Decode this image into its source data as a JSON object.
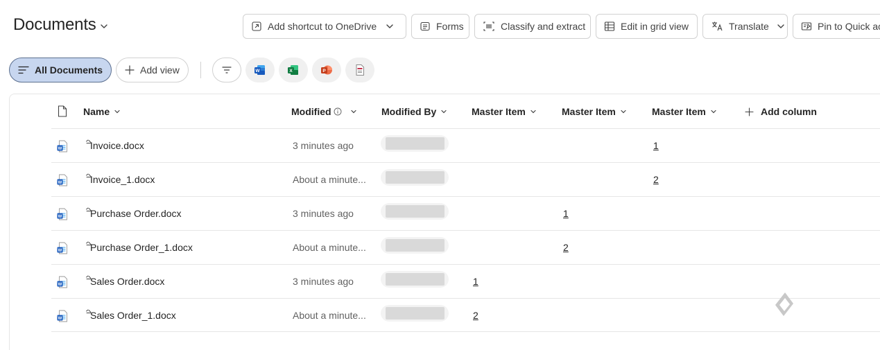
{
  "header": {
    "title": "Documents"
  },
  "commands": [
    {
      "label": "Add shortcut to OneDrive",
      "icon": "shortcut-icon",
      "dropdown": true
    },
    {
      "label": "Forms",
      "icon": "forms-icon",
      "dropdown": false
    },
    {
      "label": "Classify and extract",
      "icon": "classify-icon",
      "dropdown": false
    },
    {
      "label": "Edit in grid view",
      "icon": "grid-icon",
      "dropdown": false
    },
    {
      "label": "Translate",
      "icon": "translate-icon",
      "dropdown": true
    },
    {
      "label": "Pin to Quick ac",
      "icon": "pin-icon",
      "dropdown": false
    }
  ],
  "views": {
    "active": "All Documents",
    "add": "Add view"
  },
  "filters": [
    "filter-icon",
    "word-icon",
    "excel-icon",
    "powerpoint-icon",
    "pdf-icon"
  ],
  "columns": {
    "name": "Name",
    "modified": "Modified",
    "modified_by": "Modified By",
    "master1": "Master Item",
    "master2": "Master Item",
    "master3": "Master Item",
    "add": "Add column"
  },
  "rows": [
    {
      "name": "Invoice.docx",
      "modified": "3 minutes ago",
      "m1": "",
      "m2": "",
      "m3": "1"
    },
    {
      "name": "Invoice_1.docx",
      "modified": "About a minute...",
      "m1": "",
      "m2": "",
      "m3": "2"
    },
    {
      "name": "Purchase Order.docx",
      "modified": "3 minutes ago",
      "m1": "",
      "m2": "1",
      "m3": ""
    },
    {
      "name": "Purchase Order_1.docx",
      "modified": "About a minute...",
      "m1": "",
      "m2": "2",
      "m3": ""
    },
    {
      "name": "Sales Order.docx",
      "modified": "3 minutes ago",
      "m1": "1",
      "m2": "",
      "m3": ""
    },
    {
      "name": "Sales Order_1.docx",
      "modified": "About a minute...",
      "m1": "2",
      "m2": "",
      "m3": ""
    }
  ],
  "colors": {
    "accent": "#c7d6ef",
    "word_blue": "#185abd",
    "excel_green": "#107c41",
    "ppt_orange": "#c43e1c",
    "pdf_red": "#c4314b"
  }
}
